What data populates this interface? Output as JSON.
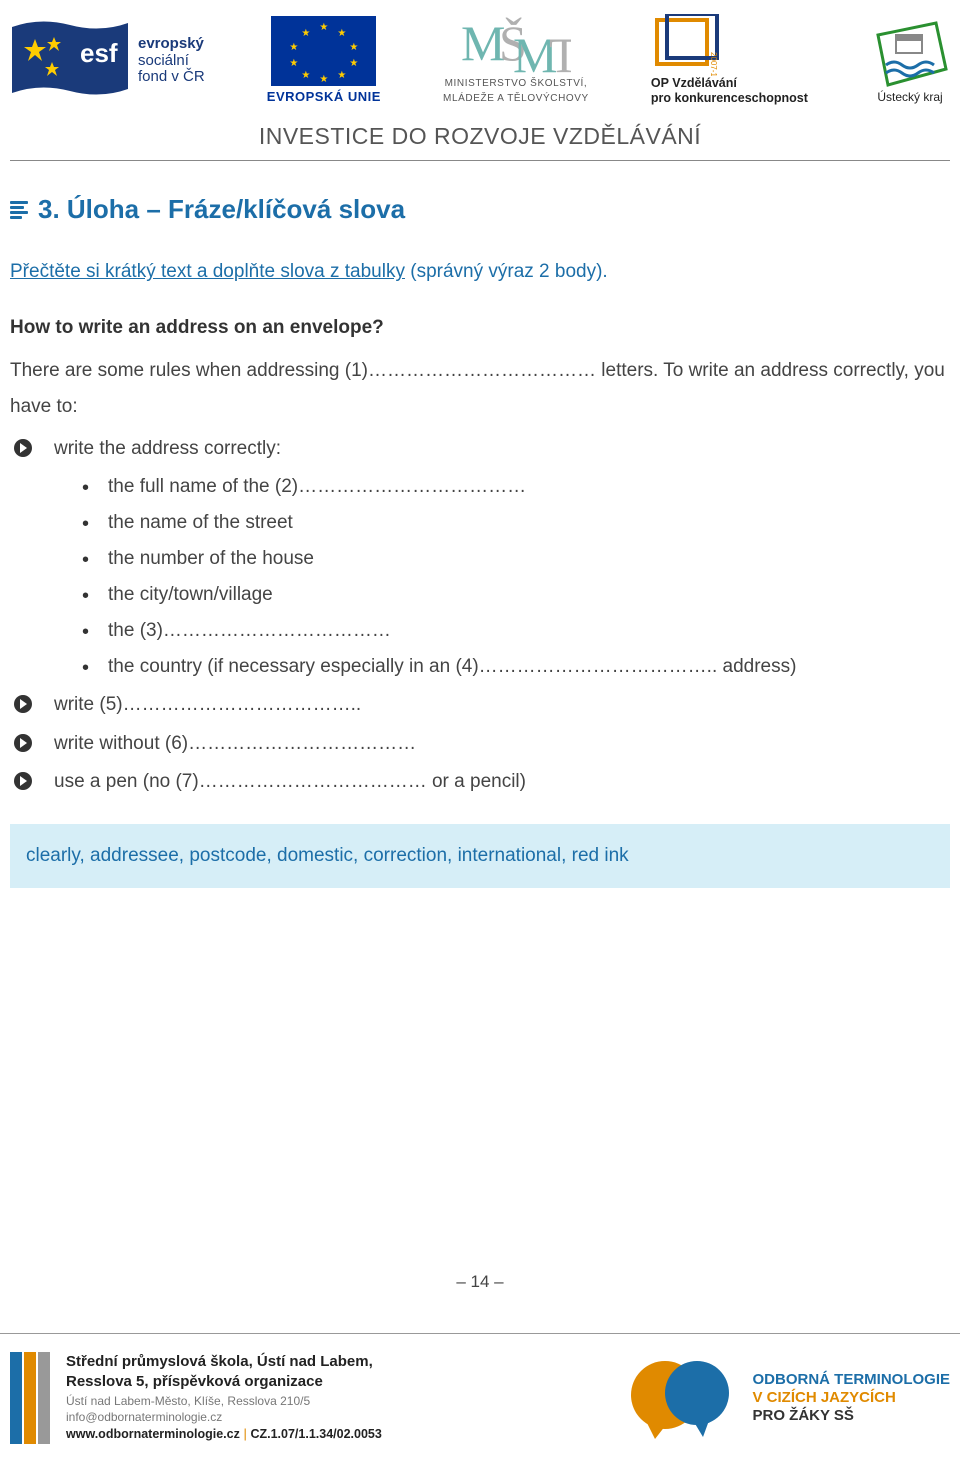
{
  "header": {
    "esf": {
      "line1": "evropský",
      "line2": "sociální",
      "line3": "fond v ČR"
    },
    "eu_caption": "EVROPSKÁ UNIE",
    "msmt_caption_1": "MINISTERSTVO ŠKOLSTVÍ,",
    "msmt_caption_2": "MLÁDEŽE A TĚLOVÝCHOVY",
    "opv_line1": "OP Vzdělávání",
    "opv_line2": "pro konkurenceschopnost",
    "kraj": "Ústecký kraj",
    "tagline": "INVESTICE DO ROZVOJE VZDĚLÁVÁNÍ"
  },
  "section": {
    "title": "3. Úloha – Fráze/klíčová slova",
    "instruct_a": "Přečtěte si krátký text a doplňte slova z tabulky",
    "instruct_b": " (správný výraz 2 body).",
    "subhead": "How to write an address on an envelope?",
    "para": "There are some rules when addressing (1)……………………………… letters. To write an address correctly, you have to:",
    "arrow1": "write the address correctly:",
    "sub": {
      "s1": "the full name of the (2)………………………………",
      "s2": "the name of the street",
      "s3": "the number of the house",
      "s4": "the city/town/village",
      "s5": "the (3)………………………………",
      "s6": "the country (if necessary especially in an (4)……………………………….. address)"
    },
    "arrow2": "write (5)………………………………..",
    "arrow3": "write without (6)………………………………",
    "arrow4": "use a pen (no (7)……………………………… or a pencil)",
    "wordbox": "clearly, addressee, postcode, domestic, correction, international, red ink"
  },
  "page_number": "– 14 –",
  "footer": {
    "school_1": "Střední průmyslová škola, Ústí nad Labem,",
    "school_2": "Resslova 5, příspěvková organizace",
    "addr": "Ústí nad Labem-Město, Klíše, Resslova 210/5",
    "email": "info@odbornaterminologie.cz",
    "url": "www.odbornaterminologie.cz",
    "sep": " | ",
    "code": "CZ.1.07/1.1.34/02.0053",
    "ot1": "ODBORNÁ TERMINOLOGIE",
    "ot2": "V CIZÍCH JAZYCÍCH",
    "ot3": "PRO ŽÁKY SŠ"
  }
}
